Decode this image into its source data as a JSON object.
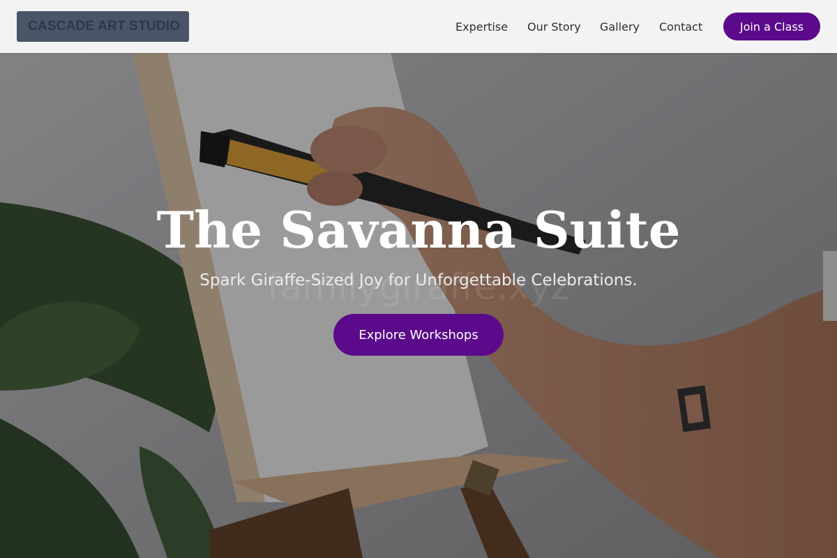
{
  "header": {
    "logo": "CASCADE ART STUDIO",
    "nav": [
      "Expertise",
      "Our Story",
      "Gallery",
      "Contact"
    ],
    "cta": "Join a Class"
  },
  "hero": {
    "title": "The Savanna Suite",
    "subtitle": "Spark Giraffe-Sized Joy for Unforgettable Celebrations.",
    "watermark": "familygiraffe.xyz",
    "button": "Explore Workshops"
  },
  "colors": {
    "accent": "#5a0a8a",
    "header_bg": "#f3f3f3",
    "logo_bg": "#4a5568",
    "logo_text": "#2d3748"
  }
}
